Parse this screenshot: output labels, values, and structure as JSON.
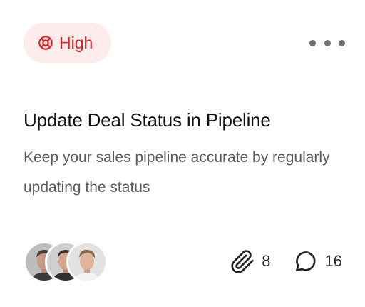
{
  "card": {
    "priority": {
      "label": "High",
      "icon": "lifebuoy-icon",
      "color": "#e5201c",
      "background": "#fdecec"
    },
    "menu_icon": "more-horizontal-icon",
    "title": "Update Deal Status in Pipeline",
    "description": "Keep your sales pipeline accurate by regularly updating the status",
    "assignees": [
      {
        "icon": "avatar-1"
      },
      {
        "icon": "avatar-2"
      },
      {
        "icon": "avatar-3"
      }
    ],
    "attachments": {
      "icon": "paperclip-icon",
      "count": "8"
    },
    "comments": {
      "icon": "comment-icon",
      "count": "16"
    }
  }
}
